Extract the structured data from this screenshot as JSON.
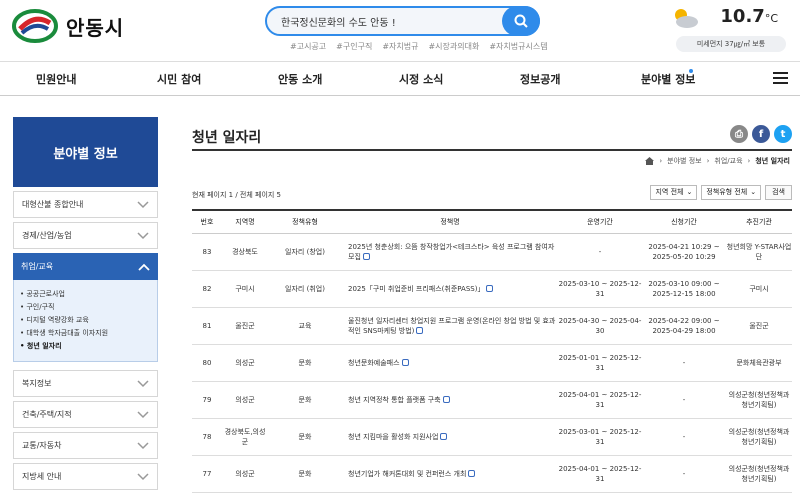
{
  "header": {
    "logo_text": "안동시",
    "search_placeholder": "한국정신문화의 수도 안동 !",
    "tags": [
      "#고시공고",
      "#구인구직",
      "#자치법규",
      "#시장과의대화",
      "#자치법규시스템"
    ],
    "temperature": "10.7",
    "temp_unit": "°C",
    "dust": "미세먼지 37㎍/㎥ 보통"
  },
  "gnb": [
    "민원안내",
    "시민 참여",
    "안동 소개",
    "시정 소식",
    "정보공개",
    "분야별 정보"
  ],
  "sidebar": {
    "title": "분야별 정보",
    "items_top": [
      "대형산불 종합안내",
      "경제/산업/농업"
    ],
    "active": "취업/교육",
    "sub": [
      "• 공공근로사업",
      "• 구인/구직",
      "• 디지털 역량강화 교육",
      "• 대학생 학자금대출 이자지원",
      "• 청년 일자리"
    ],
    "items_bottom": [
      "복지정보",
      "건축/주택/지적",
      "교통/자동차",
      "지방세 안내"
    ]
  },
  "main": {
    "title": "청년 일자리",
    "breadcrumb": [
      "분야별 정보",
      "취업/교육",
      "청년 일자리"
    ],
    "page_info": "현재 페이지 1 / 전체 페이지 5",
    "filter_region": "지역 전체",
    "filter_type": "정책유형 전체",
    "search_btn": "검색",
    "columns": [
      "번호",
      "지역명",
      "정책유형",
      "정책명",
      "운영기간",
      "신청기간",
      "추진기관"
    ],
    "rows": [
      [
        "83",
        "경상북도",
        "일자리 (창업)",
        "2025년 청춘상회: 으뜸 창작창업가<테크스타> 육성 프로그램 참여자 모집",
        "-",
        "2025-04-21 10:29 ~ 2025-05-20 10:29",
        "청년희망 Y-STAR사업단"
      ],
      [
        "82",
        "구미시",
        "일자리 (취업)",
        "2025「구미 취업준비 프리패스(취준PASS)」",
        "2025-03-10 ~ 2025-12-31",
        "2025-03-10 09:00 ~ 2025-12-15 18:00",
        "구미시"
      ],
      [
        "81",
        "울진군",
        "교육",
        "울진청년 일자리센터 창업지원 프로그램 운영(온라인 창업 방법 및 효과적인 SNS마케팅 방법)",
        "2025-04-30 ~ 2025-04-30",
        "2025-04-22 09:00 ~ 2025-04-29 18:00",
        "울진군"
      ],
      [
        "80",
        "의성군",
        "문화",
        "청년문화예술패스",
        "2025-01-01 ~ 2025-12-31",
        "-",
        "문화체육관광부"
      ],
      [
        "79",
        "의성군",
        "문화",
        "청년 지역정착 통합 플랫폼 구축",
        "2025-04-01 ~ 2025-12-31",
        "-",
        "의성군청(청년정책과 청년기획팀)"
      ],
      [
        "78",
        "경상북도,의성군",
        "문화",
        "청년 지킴마을 활성화 지원사업",
        "2025-03-01 ~ 2025-12-31",
        "-",
        "의성군청(청년정책과 청년기획팀)"
      ],
      [
        "77",
        "의성군",
        "문화",
        "청년기업가 해커톤대회 및 컨퍼런스 개최",
        "2025-04-01 ~ 2025-12-31",
        "-",
        "의성군청(청년정책과 청년기획팀)"
      ]
    ]
  }
}
